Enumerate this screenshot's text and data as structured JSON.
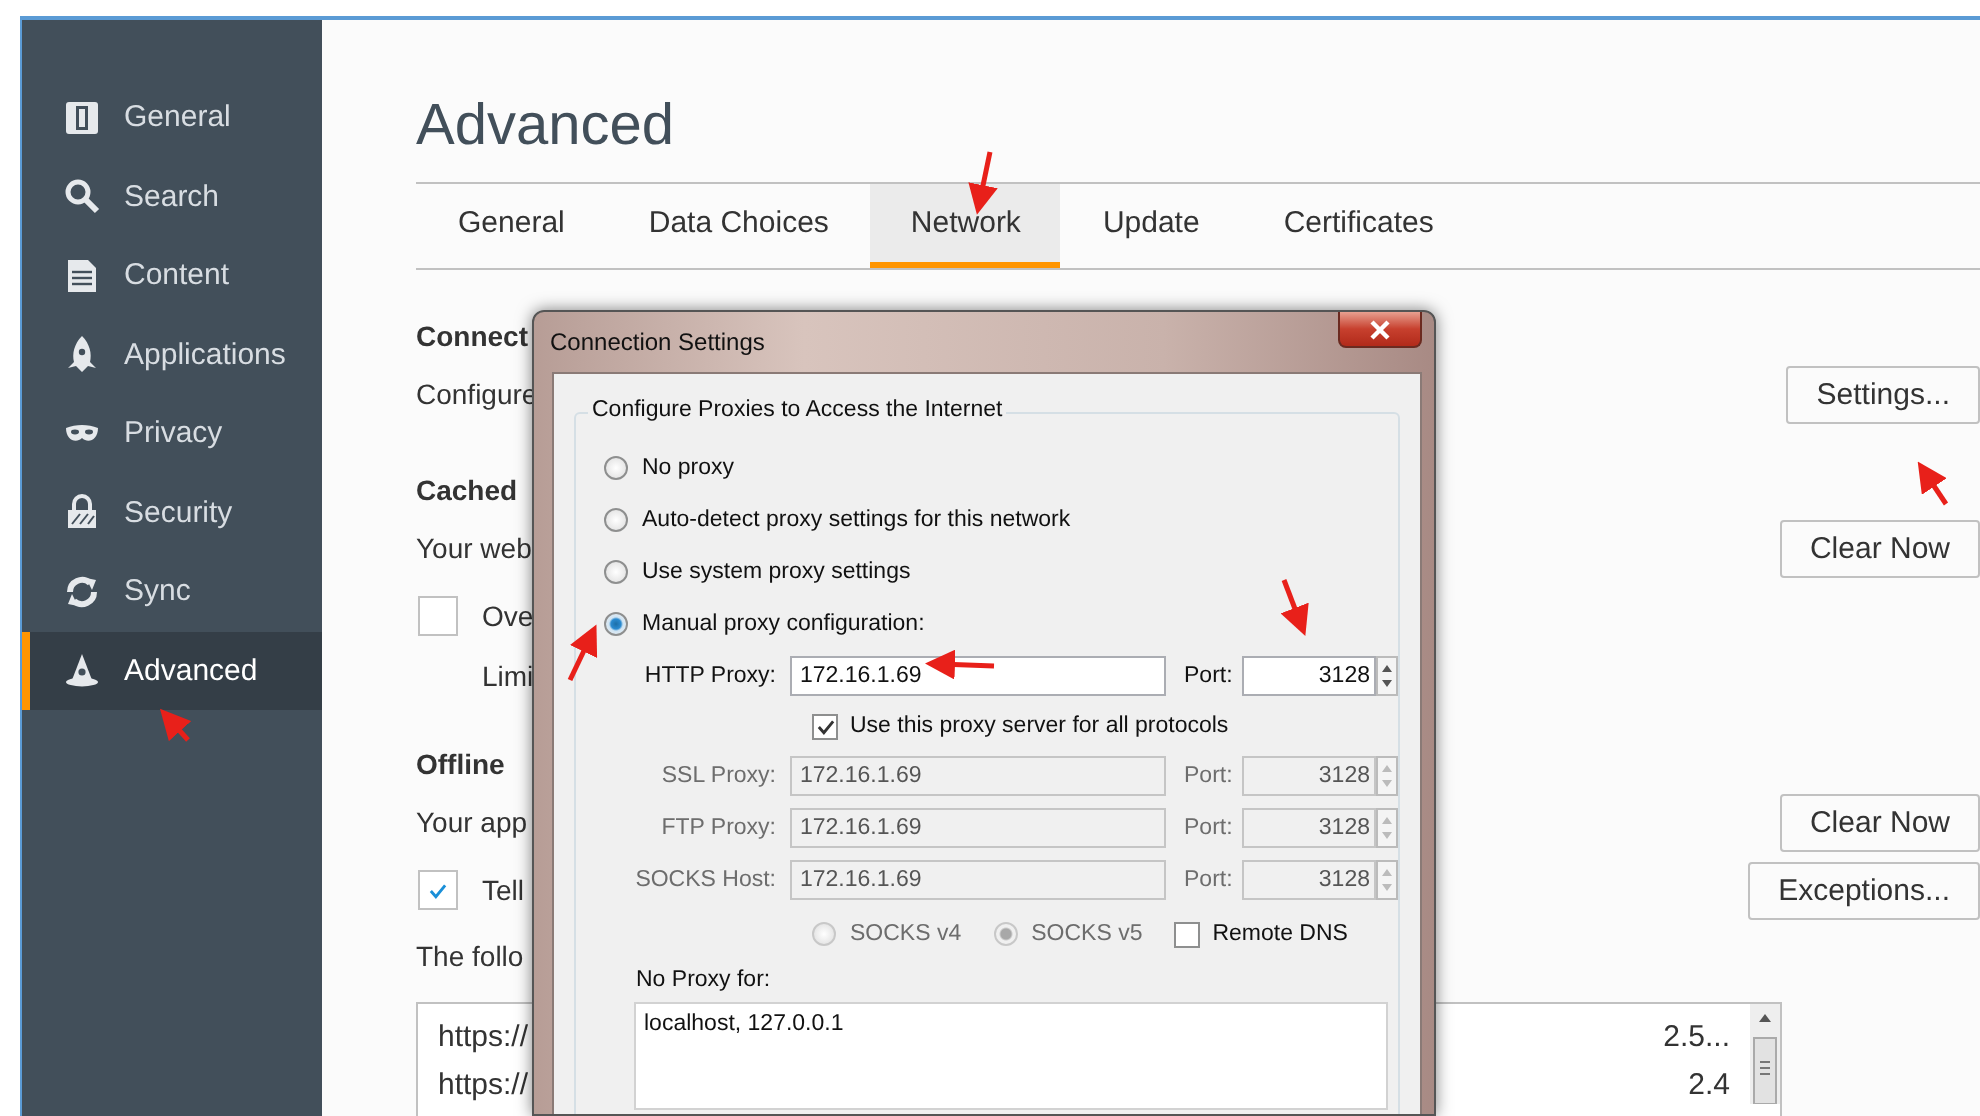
{
  "sidebar": {
    "items": [
      {
        "kind": "general",
        "label": "General",
        "selected": false
      },
      {
        "kind": "search",
        "label": "Search",
        "selected": false
      },
      {
        "kind": "content",
        "label": "Content",
        "selected": false
      },
      {
        "kind": "applications",
        "label": "Applications",
        "selected": false
      },
      {
        "kind": "privacy",
        "label": "Privacy",
        "selected": false
      },
      {
        "kind": "security",
        "label": "Security",
        "selected": false
      },
      {
        "kind": "sync",
        "label": "Sync",
        "selected": false
      },
      {
        "kind": "advanced",
        "label": "Advanced",
        "selected": true
      }
    ]
  },
  "header": {
    "title": "Advanced"
  },
  "tabs": [
    {
      "label": "General",
      "selected": false
    },
    {
      "label": "Data Choices",
      "selected": false
    },
    {
      "label": "Network",
      "selected": true
    },
    {
      "label": "Update",
      "selected": false
    },
    {
      "label": "Certificates",
      "selected": false
    }
  ],
  "sections": [
    {
      "heading": "Connect",
      "rows": [
        {
          "kind": "text",
          "text": "Configure",
          "button": "Settings..."
        }
      ]
    },
    {
      "heading": "Cached",
      "rows": [
        {
          "kind": "text",
          "text": "Your web",
          "button": "Clear Now"
        },
        {
          "kind": "checkbox",
          "checked": false,
          "label": "Ove"
        },
        {
          "kind": "indent",
          "text": "Limi"
        }
      ]
    },
    {
      "heading": "Offline",
      "rows": [
        {
          "kind": "text",
          "text": "Your app",
          "button": "Clear Now"
        },
        {
          "kind": "checkbox",
          "checked": true,
          "label": "Tell",
          "button": "Exceptions..."
        },
        {
          "kind": "text",
          "text": "The follo"
        }
      ]
    }
  ],
  "site_list": {
    "rows": [
      {
        "column_1": "https://",
        "column_2": "2.5..."
      },
      {
        "column_1": "https://",
        "column_2": "2.4"
      }
    ]
  },
  "dialog": {
    "title": "Connection Settings",
    "group_title": "Configure Proxies to Access the Internet",
    "proxy_modes": [
      {
        "label": "No proxy",
        "selected": false
      },
      {
        "label": "Auto-detect proxy settings for this network",
        "selected": false
      },
      {
        "label": "Use system proxy settings",
        "selected": false
      },
      {
        "label": "Manual proxy configuration:",
        "selected": true
      }
    ],
    "proxies": [
      {
        "label": "HTTP Proxy:",
        "value": "172.16.1.69",
        "port_label": "Port:",
        "port": "3128",
        "disabled": false
      },
      {
        "label": "SSL Proxy:",
        "value": "172.16.1.69",
        "port_label": "Port:",
        "port": "3128",
        "disabled": true
      },
      {
        "label": "FTP Proxy:",
        "value": "172.16.1.69",
        "port_label": "Port:",
        "port": "3128",
        "disabled": true
      },
      {
        "label": "SOCKS Host:",
        "value": "172.16.1.69",
        "port_label": "Port:",
        "port": "3128",
        "disabled": true
      }
    ],
    "share_all": {
      "label": "Use this proxy server for all protocols",
      "checked": true
    },
    "socks_versions": [
      {
        "label": "SOCKS v4",
        "selected": false,
        "disabled": true
      },
      {
        "label": "SOCKS v5",
        "selected": true,
        "disabled": true
      }
    ],
    "remote_dns": {
      "label": "Remote DNS",
      "checked": false
    },
    "no_proxy": {
      "label": "No Proxy for:",
      "value": "localhost, 127.0.0.1"
    }
  }
}
